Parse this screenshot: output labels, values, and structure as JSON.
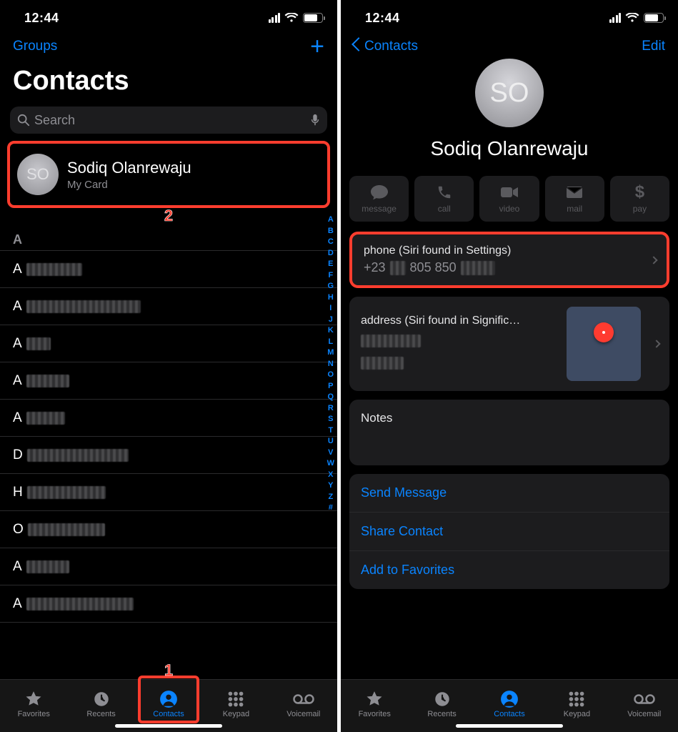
{
  "status_time": "12:44",
  "colors": {
    "accent": "#0a84ff",
    "highlight": "#ff3d2e"
  },
  "left": {
    "nav_groups": "Groups",
    "title": "Contacts",
    "search_placeholder": "Search",
    "my_card": {
      "initials": "SO",
      "name": "Sodiq Olanrewaju",
      "subtitle": "My Card"
    },
    "callouts": {
      "card": "2",
      "tab": "1"
    },
    "section_letter": "A",
    "contacts": [
      {
        "prefix": "A"
      },
      {
        "prefix": "A"
      },
      {
        "prefix": "A"
      },
      {
        "prefix": "A"
      },
      {
        "prefix": "A"
      },
      {
        "prefix": "D"
      },
      {
        "prefix": "H"
      },
      {
        "prefix": "O"
      },
      {
        "prefix": "A"
      },
      {
        "prefix": "A"
      }
    ],
    "index_letters": [
      "A",
      "B",
      "C",
      "D",
      "E",
      "F",
      "G",
      "H",
      "I",
      "J",
      "K",
      "L",
      "M",
      "N",
      "O",
      "P",
      "Q",
      "R",
      "S",
      "T",
      "U",
      "V",
      "W",
      "X",
      "Y",
      "Z",
      "#"
    ],
    "tabs": [
      {
        "key": "favorites",
        "label": "Favorites"
      },
      {
        "key": "recents",
        "label": "Recents"
      },
      {
        "key": "contacts",
        "label": "Contacts",
        "active": true,
        "highlight": true
      },
      {
        "key": "keypad",
        "label": "Keypad"
      },
      {
        "key": "voicemail",
        "label": "Voicemail"
      }
    ]
  },
  "right": {
    "back_label": "Contacts",
    "edit_label": "Edit",
    "avatar_initials": "SO",
    "name": "Sodiq Olanrewaju",
    "actions": [
      {
        "key": "message",
        "label": "message"
      },
      {
        "key": "call",
        "label": "call"
      },
      {
        "key": "video",
        "label": "video"
      },
      {
        "key": "mail",
        "label": "mail"
      },
      {
        "key": "pay",
        "label": "pay"
      }
    ],
    "phone": {
      "label": "phone (Siri found in Settings)",
      "value_visible_prefix": "+23",
      "value_visible_mid": "805 850"
    },
    "address": {
      "label": "address (Siri found in Signific…"
    },
    "notes_label": "Notes",
    "links": {
      "send_message": "Send Message",
      "share_contact": "Share Contact",
      "add_fav": "Add to Favorites"
    },
    "tabs": [
      {
        "key": "favorites",
        "label": "Favorites"
      },
      {
        "key": "recents",
        "label": "Recents"
      },
      {
        "key": "contacts",
        "label": "Contacts",
        "active": true
      },
      {
        "key": "keypad",
        "label": "Keypad"
      },
      {
        "key": "voicemail",
        "label": "Voicemail"
      }
    ]
  }
}
